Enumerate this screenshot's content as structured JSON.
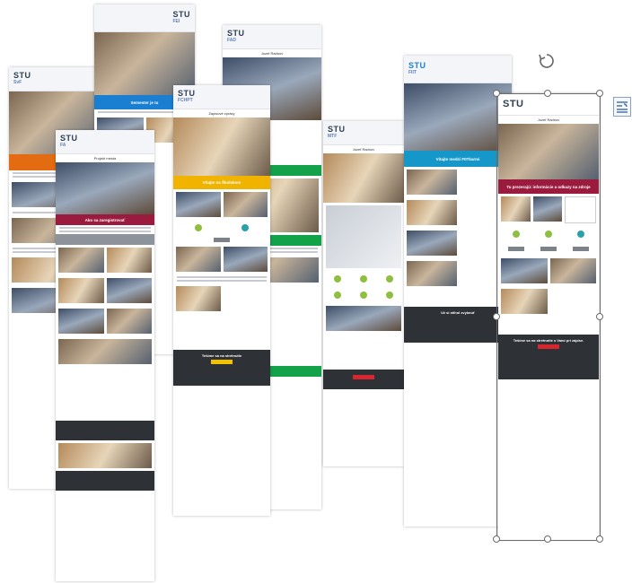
{
  "newsletters": {
    "n1": {
      "logo": "STU",
      "sub": "SvF",
      "title": "",
      "hero_band": "",
      "footer": ""
    },
    "n2": {
      "logo": "STU",
      "sub": "FA",
      "title": "Projekt mesta",
      "hero_band": "Ako sa zaregistrovať",
      "footer": ""
    },
    "n3": {
      "logo": "STU",
      "sub": "FEI",
      "title": "",
      "hero_band": "Semester je tu",
      "footer": ""
    },
    "n4": {
      "logo": "STU",
      "sub": "FCHPT",
      "title": "Zapisové zprávy",
      "hero_band": "Vitajte na Školskom",
      "footer": "Tešíme sa na stretnutie"
    },
    "n5": {
      "logo": "STU",
      "sub": "FAD",
      "title": "Jozef Radnov",
      "hero_band": "",
      "footer": ""
    },
    "n6": {
      "logo": "STU",
      "sub": "MTF",
      "title": "Jozef Radnov",
      "hero_band": "Sledujte",
      "footer": ""
    },
    "n7": {
      "logo": "STU",
      "sub": "FIIT",
      "title": "",
      "hero_band": "Vitajte medzi FIITkarmi",
      "footer": "Už si stihol zvyknúť"
    },
    "n8": {
      "logo": "STU",
      "sub": "",
      "title": "Jozef Radnov",
      "hero_band": "Tu prezerajú: informácie a odkazy na zdroje",
      "footer": "Tešíme sa na stretnutie s Vami pri zápise."
    }
  },
  "colors": {
    "blue": "#1a7fd0",
    "orange": "#e36b12",
    "yellow": "#f0b400",
    "green": "#13a24a",
    "maroon": "#9a1b3d",
    "dark": "#2e3236"
  },
  "icons": {
    "rotate": "rotate-icon",
    "layout": "text-wrap-icon"
  }
}
